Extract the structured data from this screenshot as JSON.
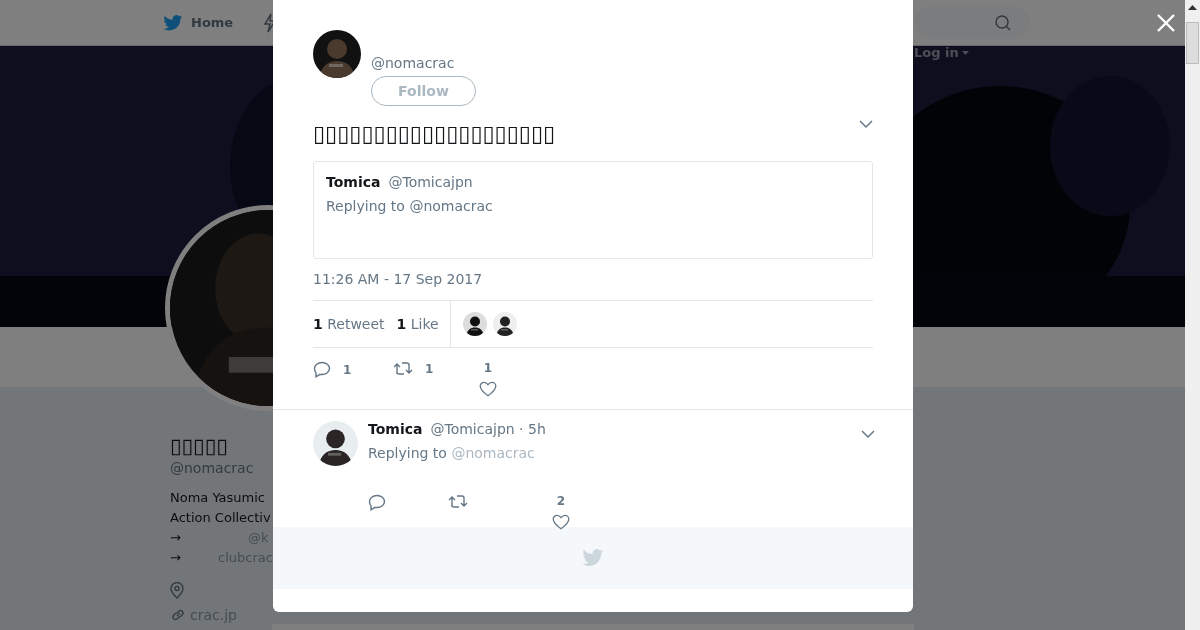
{
  "background_page": {
    "nav": {
      "home": "Home",
      "login": "Log in"
    },
    "profile": {
      "name": "▯▯▯▯▯",
      "handle": "@nomacrac",
      "bio_lines": [
        "Noma Yasumic",
        "Action Collectiv"
      ],
      "links": [
        {
          "arrow": "→",
          "text": "@k"
        },
        {
          "arrow": "→",
          "text": "clubcrac"
        }
      ],
      "website": "crac.jp"
    }
  },
  "modal": {
    "tweet": {
      "handle": "@nomacrac",
      "follow": "Follow",
      "text": "▯▯▯▯▯▯▯▯▯▯▯▯▯▯▯▯▯▯▯▯",
      "quoted": {
        "name": "Tomica",
        "handle": "@Tomicajpn",
        "reply": "Replying to @nomacrac"
      },
      "timestamp": "11:26 AM - 17 Sep 2017",
      "stats": [
        {
          "count": "1",
          "label": "Retweet"
        },
        {
          "count": "1",
          "label": "Like"
        }
      ],
      "actions": [
        {
          "kind": "reply",
          "count": "1"
        },
        {
          "kind": "retweet",
          "count": "1"
        },
        {
          "kind": "like",
          "count": "1"
        }
      ]
    },
    "replies": [
      {
        "name": "Tomica",
        "meta": "@Tomicajpn · 5h",
        "reply_prefix": "Replying to",
        "reply_to": "@nomacrac",
        "actions": [
          {
            "kind": "reply"
          },
          {
            "kind": "retweet"
          },
          {
            "kind": "like",
            "count": "2"
          }
        ]
      }
    ]
  }
}
